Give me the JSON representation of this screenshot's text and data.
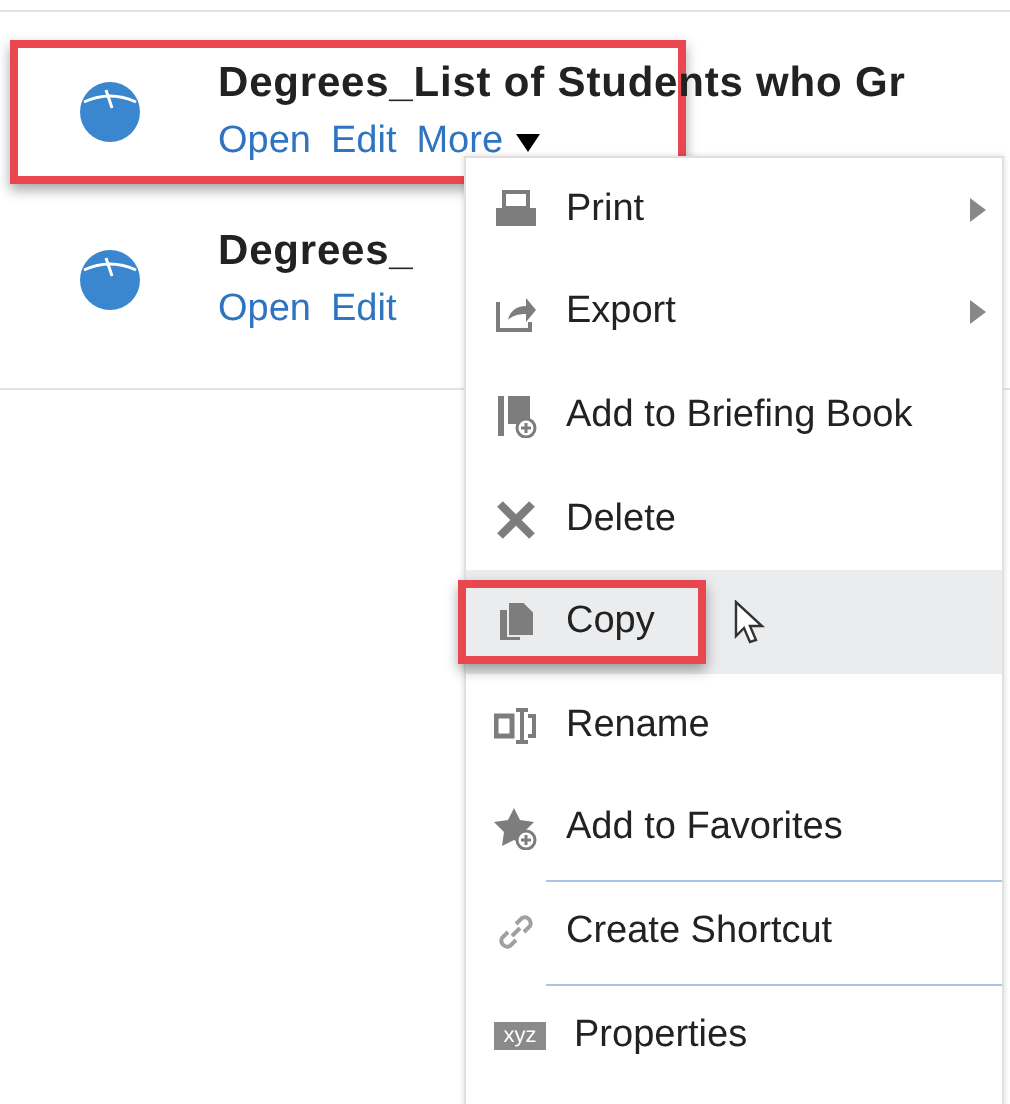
{
  "items": [
    {
      "title": "Degrees_List of Students who Gr",
      "links": [
        "Open",
        "Edit",
        "More"
      ],
      "more_menu": true,
      "callout": true
    },
    {
      "title": "Degrees_",
      "links": [
        "Open",
        "Edit"
      ],
      "more_menu": false,
      "callout": false
    }
  ],
  "menu": {
    "items": [
      {
        "kind": "print",
        "label": "Print",
        "submenu": true,
        "hovered": false,
        "callout": false,
        "separator_before": false
      },
      {
        "kind": "export",
        "label": "Export",
        "submenu": true,
        "hovered": false,
        "callout": false,
        "separator_before": false
      },
      {
        "kind": "briefing",
        "label": "Add to Briefing Book",
        "submenu": false,
        "hovered": false,
        "callout": false,
        "separator_before": false
      },
      {
        "kind": "delete",
        "label": "Delete",
        "submenu": false,
        "hovered": false,
        "callout": false,
        "separator_before": false
      },
      {
        "kind": "copy",
        "label": "Copy",
        "submenu": false,
        "hovered": true,
        "callout": true,
        "separator_before": false
      },
      {
        "kind": "rename",
        "label": "Rename",
        "submenu": false,
        "hovered": false,
        "callout": false,
        "separator_before": false
      },
      {
        "kind": "favorite",
        "label": "Add to Favorites",
        "submenu": false,
        "hovered": false,
        "callout": false,
        "separator_before": false
      },
      {
        "kind": "shortcut",
        "label": "Create Shortcut",
        "submenu": false,
        "hovered": false,
        "callout": false,
        "separator_before": true
      },
      {
        "kind": "properties",
        "label": "Properties",
        "badge": "xyz",
        "submenu": false,
        "hovered": false,
        "callout": false,
        "separator_before": true
      }
    ]
  }
}
